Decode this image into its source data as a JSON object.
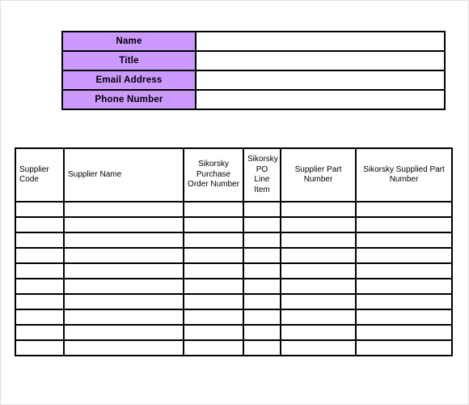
{
  "theme": {
    "label_fill": "#cc99ff",
    "border_color": "#000000",
    "page_background": "#ffffff",
    "text_color": "#000000"
  },
  "contact_form": {
    "rows": [
      {
        "label": "Name",
        "value": ""
      },
      {
        "label": "Title",
        "value": ""
      },
      {
        "label": "Email Address",
        "value": ""
      },
      {
        "label": "Phone Number",
        "value": ""
      }
    ]
  },
  "supplier_table": {
    "columns": [
      {
        "header": "Supplier Code",
        "align": "left"
      },
      {
        "header": "Supplier Name",
        "align": "left"
      },
      {
        "header": "Sikorsky Purchase Order Number",
        "align": "center"
      },
      {
        "header": "Sikorsky PO Line Item",
        "align": "center"
      },
      {
        "header": "Supplier Part Number",
        "align": "center"
      },
      {
        "header": "Sikorsky Supplied Part Number",
        "align": "center"
      }
    ],
    "rows": [
      [
        "",
        "",
        "",
        "",
        "",
        ""
      ],
      [
        "",
        "",
        "",
        "",
        "",
        ""
      ],
      [
        "",
        "",
        "",
        "",
        "",
        ""
      ],
      [
        "",
        "",
        "",
        "",
        "",
        ""
      ],
      [
        "",
        "",
        "",
        "",
        "",
        ""
      ],
      [
        "",
        "",
        "",
        "",
        "",
        ""
      ],
      [
        "",
        "",
        "",
        "",
        "",
        ""
      ],
      [
        "",
        "",
        "",
        "",
        "",
        ""
      ],
      [
        "",
        "",
        "",
        "",
        "",
        ""
      ],
      [
        "",
        "",
        "",
        "",
        "",
        ""
      ]
    ]
  }
}
